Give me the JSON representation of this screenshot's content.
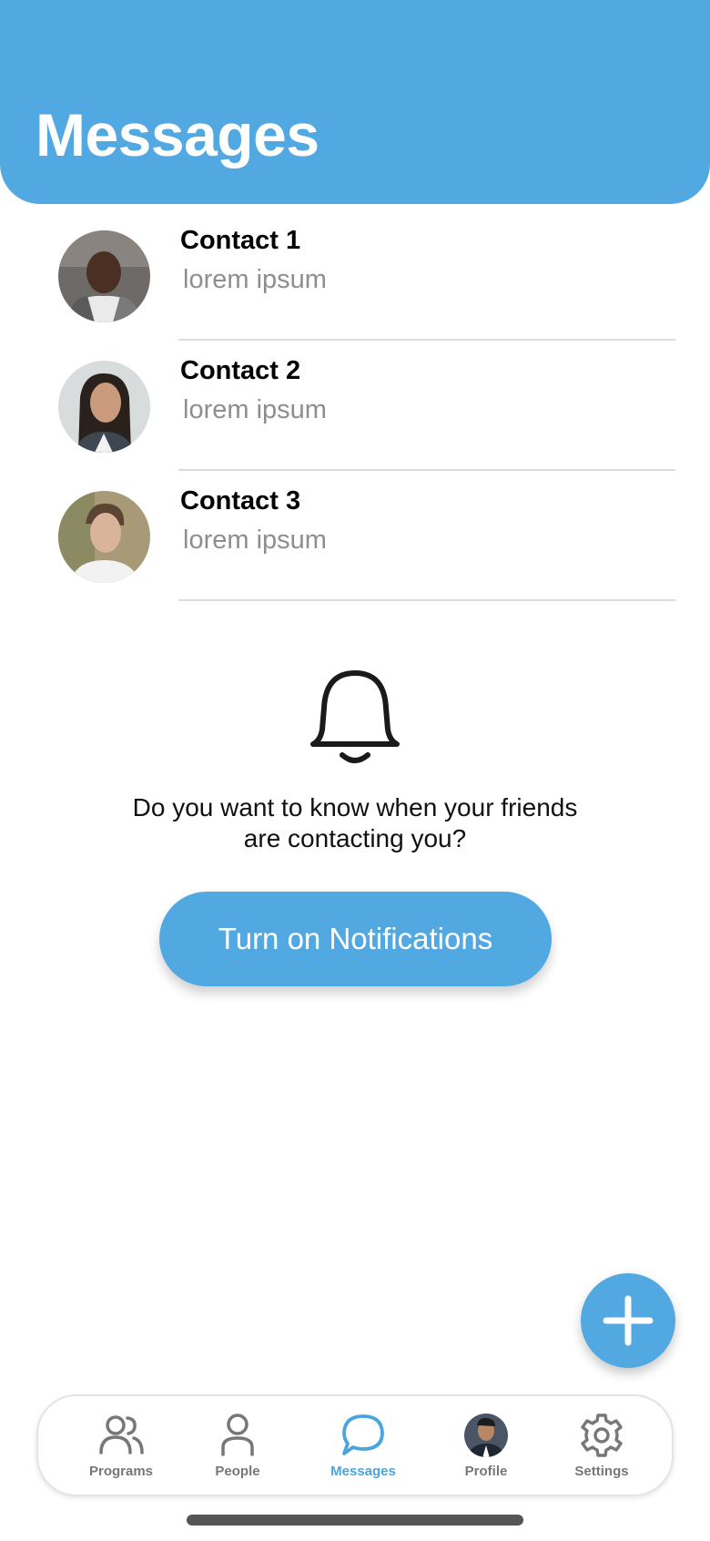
{
  "header": {
    "title": "Messages"
  },
  "contacts": [
    {
      "name": "Contact 1",
      "preview": "lorem ipsum",
      "avatar_icon": "avatar-photo"
    },
    {
      "name": "Contact 2",
      "preview": "lorem ipsum",
      "avatar_icon": "avatar-photo"
    },
    {
      "name": "Contact 3",
      "preview": "lorem ipsum",
      "avatar_icon": "avatar-photo"
    }
  ],
  "notifications": {
    "icon": "bell-icon",
    "prompt_line1": "Do you want to know when your friends",
    "prompt_line2": "are contacting you?",
    "button_label": "Turn on Notifications"
  },
  "fab": {
    "icon": "plus-icon"
  },
  "tabbar": {
    "active": "Messages",
    "items": [
      {
        "label": "Programs",
        "icon": "people-group-icon"
      },
      {
        "label": "People",
        "icon": "person-icon"
      },
      {
        "label": "Messages",
        "icon": "chat-bubble-icon"
      },
      {
        "label": "Profile",
        "icon": "profile-avatar"
      },
      {
        "label": "Settings",
        "icon": "gear-icon"
      }
    ]
  },
  "colors": {
    "accent": "#52a8e0",
    "active_tab": "#4aa5de",
    "inactive_tab": "#777777",
    "preview_text": "#8e8e8e"
  }
}
